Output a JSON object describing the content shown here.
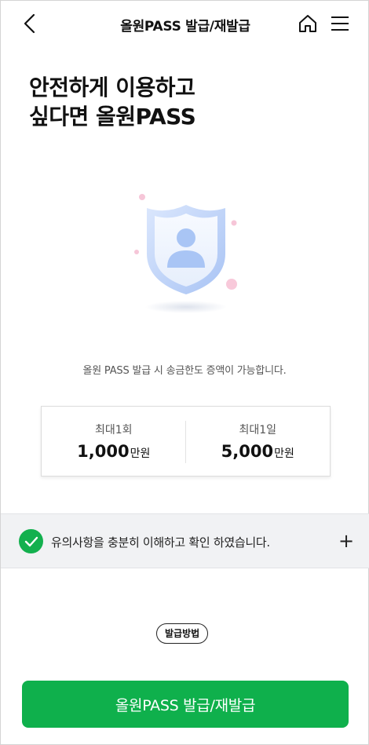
{
  "header": {
    "title": "올원PASS 발급/재발급",
    "back_icon": "chevron-left-icon",
    "home_icon": "home-icon",
    "menu_icon": "hamburger-menu-icon"
  },
  "headline": {
    "line1": "안전하게 이용하고",
    "line2": "싶다면 올원PASS"
  },
  "illustration": {
    "icon": "shield-user-icon"
  },
  "description": "올원 PASS 발급 시 송금한도 증액이 가능합니다.",
  "limits": [
    {
      "label": "최대1회",
      "amount": "1,000",
      "unit": "만원"
    },
    {
      "label": "최대1일",
      "amount": "5,000",
      "unit": "만원"
    }
  ],
  "notice": {
    "checked": true,
    "text": "유의사항을 충분히 이해하고 확인 하였습니다.",
    "expand_symbol": "+"
  },
  "method_label": "발급방법",
  "primary_button": "올원PASS 발급/재발급",
  "colors": {
    "brand_green": "#0fb04c",
    "notice_bg": "#f1f2f4",
    "shield_blue": "#a9c5f5"
  }
}
